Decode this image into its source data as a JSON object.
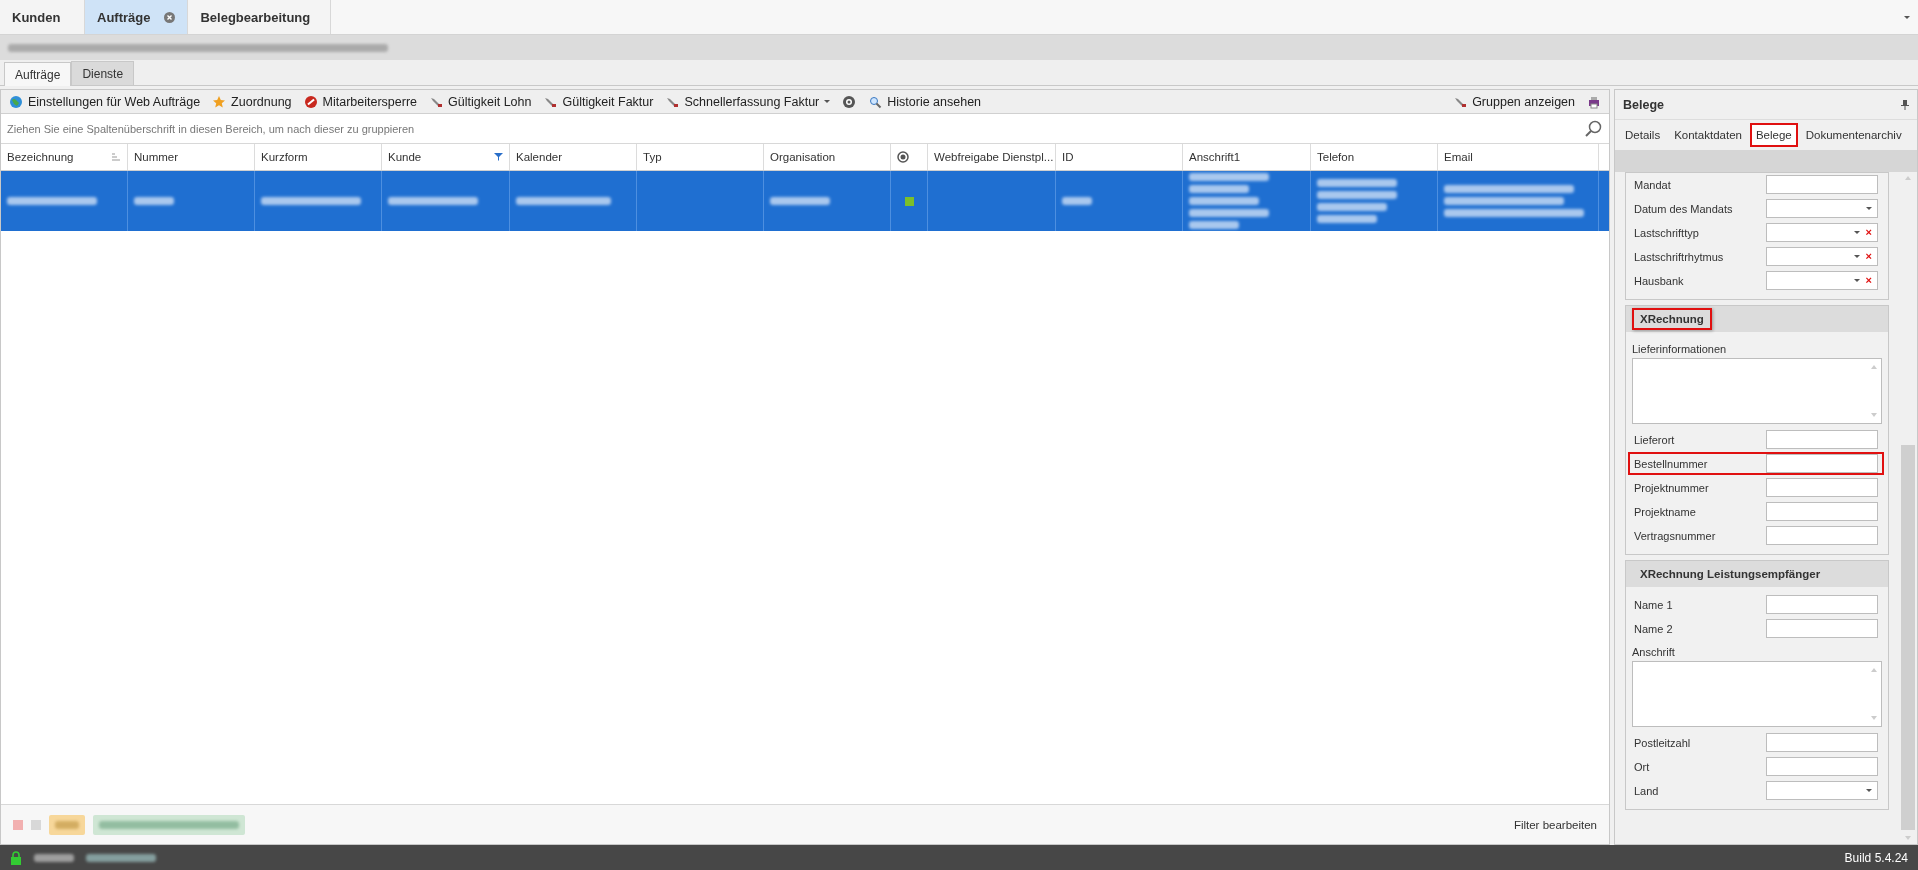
{
  "doc_tabs": [
    {
      "label": "Kunden",
      "selected": false,
      "closable": false
    },
    {
      "label": "Aufträge",
      "selected": true,
      "closable": true
    },
    {
      "label": "Belegbearbeitung",
      "selected": false,
      "closable": false
    }
  ],
  "sub_tabs": [
    {
      "label": "Aufträge",
      "selected": true
    },
    {
      "label": "Dienste",
      "selected": false
    }
  ],
  "toolbar": {
    "items": [
      {
        "kind": "button",
        "label": "Einstellungen für Web Aufträge",
        "dropdown": false
      },
      {
        "kind": "button",
        "label": "Zuordnung",
        "dropdown": false
      },
      {
        "kind": "button",
        "label": "Mitarbeitersperre",
        "dropdown": false
      },
      {
        "kind": "button",
        "label": "Gültigkeit Lohn",
        "dropdown": false
      },
      {
        "kind": "button",
        "label": "Gültigkeit Faktur",
        "dropdown": false
      },
      {
        "kind": "button",
        "label": "Schnellerfassung Faktur",
        "dropdown": true
      },
      {
        "kind": "icon_button"
      },
      {
        "kind": "button",
        "label": "Historie ansehen",
        "dropdown": false
      }
    ],
    "right": [
      {
        "kind": "button",
        "label": "Gruppen anzeigen",
        "dropdown": false
      },
      {
        "kind": "icon_button"
      }
    ]
  },
  "group_panel": {
    "placeholder": "Ziehen Sie eine Spaltenüberschrift in diesen Bereich, um nach dieser zu gruppieren"
  },
  "table": {
    "columns": [
      {
        "kind": "text",
        "label": "Bezeichnung",
        "sorted": true,
        "filtered": false
      },
      {
        "kind": "text",
        "label": "Nummer",
        "sorted": false,
        "filtered": false
      },
      {
        "kind": "text",
        "label": "Kurzform",
        "sorted": false,
        "filtered": false
      },
      {
        "kind": "text",
        "label": "Kunde",
        "sorted": false,
        "filtered": true
      },
      {
        "kind": "text",
        "label": "Kalender",
        "sorted": false,
        "filtered": false
      },
      {
        "kind": "text",
        "label": "Typ",
        "sorted": false,
        "filtered": false
      },
      {
        "kind": "text",
        "label": "Organisation",
        "sorted": false,
        "filtered": false
      },
      {
        "kind": "icon",
        "sorted": false,
        "filtered": false
      },
      {
        "kind": "text",
        "label": "Webfreigabe Dienstpl...",
        "sorted": false,
        "filtered": false
      },
      {
        "kind": "text",
        "label": "ID",
        "sorted": false,
        "filtered": false
      },
      {
        "kind": "text",
        "label": "Anschrift1",
        "sorted": false,
        "filtered": false
      },
      {
        "kind": "text",
        "label": "Telefon",
        "sorted": false,
        "filtered": false
      },
      {
        "kind": "text",
        "label": "Email",
        "sorted": false,
        "filtered": false
      }
    ],
    "rows": [
      {
        "selected": true
      }
    ]
  },
  "footer": {
    "filter_button": "Filter bearbeiten"
  },
  "side_panel": {
    "title": "Belege",
    "tabs": [
      {
        "label": "Details",
        "selected": false,
        "highlighted": false
      },
      {
        "label": "Kontaktdaten",
        "selected": false,
        "highlighted": false
      },
      {
        "label": "Belege",
        "selected": true,
        "highlighted": true
      },
      {
        "label": "Dokumentenarchiv",
        "selected": false,
        "highlighted": false
      }
    ],
    "sections": [
      {
        "fields": [
          {
            "label": "Mandat",
            "kind": "text",
            "highlighted": false
          },
          {
            "label": "Datum des Mandats",
            "kind": "combo",
            "highlighted": false
          },
          {
            "label": "Lastschrifttyp",
            "kind": "combo",
            "clear": "×",
            "highlighted": false
          },
          {
            "label": "Lastschriftrhytmus",
            "kind": "combo",
            "clear": "×",
            "highlighted": false
          },
          {
            "label": "Hausbank",
            "kind": "combo",
            "clear": "×",
            "highlighted": false
          }
        ]
      },
      {
        "title": "XRechnung",
        "highlighted": true,
        "fields": [
          {
            "label": "Lieferinformationen",
            "kind": "memo",
            "highlighted": false
          },
          {
            "label": "Lieferort",
            "kind": "text",
            "highlighted": false
          },
          {
            "label": "Bestellnummer",
            "kind": "text",
            "highlighted": true
          },
          {
            "label": "Projektnummer",
            "kind": "text",
            "highlighted": false
          },
          {
            "label": "Projektname",
            "kind": "text",
            "highlighted": false
          },
          {
            "label": "Vertragsnummer",
            "kind": "text",
            "highlighted": false
          }
        ]
      },
      {
        "title": "XRechnung Leistungsempfänger",
        "highlighted": false,
        "fields": [
          {
            "label": "Name 1",
            "kind": "text",
            "highlighted": false
          },
          {
            "label": "Name 2",
            "kind": "text",
            "highlighted": false
          },
          {
            "label": "Anschrift",
            "kind": "memo",
            "highlighted": false
          },
          {
            "label": "Postleitzahl",
            "kind": "text",
            "highlighted": false
          },
          {
            "label": "Ort",
            "kind": "text",
            "highlighted": false
          },
          {
            "label": "Land",
            "kind": "combo",
            "highlighted": false
          }
        ]
      }
    ]
  },
  "status_bar": {
    "build": "Build 5.4.24"
  }
}
